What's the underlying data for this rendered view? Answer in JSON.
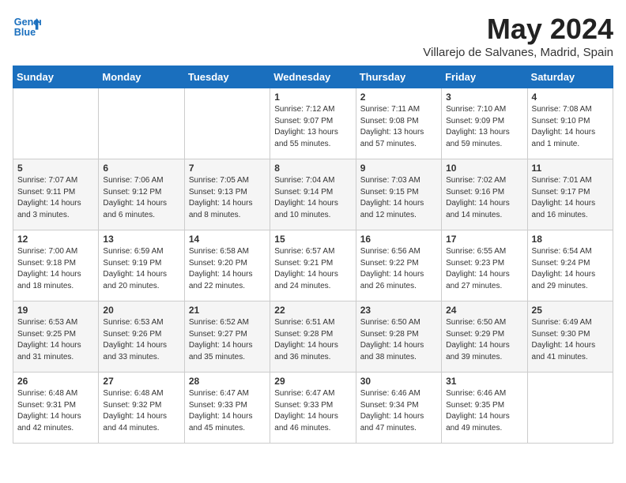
{
  "header": {
    "logo_line1": "General",
    "logo_line2": "Blue",
    "month_title": "May 2024",
    "location": "Villarejo de Salvanes, Madrid, Spain"
  },
  "weekdays": [
    "Sunday",
    "Monday",
    "Tuesday",
    "Wednesday",
    "Thursday",
    "Friday",
    "Saturday"
  ],
  "weeks": [
    [
      {
        "day": "",
        "sunrise": "",
        "sunset": "",
        "daylight": ""
      },
      {
        "day": "",
        "sunrise": "",
        "sunset": "",
        "daylight": ""
      },
      {
        "day": "",
        "sunrise": "",
        "sunset": "",
        "daylight": ""
      },
      {
        "day": "1",
        "sunrise": "Sunrise: 7:12 AM",
        "sunset": "Sunset: 9:07 PM",
        "daylight": "Daylight: 13 hours and 55 minutes."
      },
      {
        "day": "2",
        "sunrise": "Sunrise: 7:11 AM",
        "sunset": "Sunset: 9:08 PM",
        "daylight": "Daylight: 13 hours and 57 minutes."
      },
      {
        "day": "3",
        "sunrise": "Sunrise: 7:10 AM",
        "sunset": "Sunset: 9:09 PM",
        "daylight": "Daylight: 13 hours and 59 minutes."
      },
      {
        "day": "4",
        "sunrise": "Sunrise: 7:08 AM",
        "sunset": "Sunset: 9:10 PM",
        "daylight": "Daylight: 14 hours and 1 minute."
      }
    ],
    [
      {
        "day": "5",
        "sunrise": "Sunrise: 7:07 AM",
        "sunset": "Sunset: 9:11 PM",
        "daylight": "Daylight: 14 hours and 3 minutes."
      },
      {
        "day": "6",
        "sunrise": "Sunrise: 7:06 AM",
        "sunset": "Sunset: 9:12 PM",
        "daylight": "Daylight: 14 hours and 6 minutes."
      },
      {
        "day": "7",
        "sunrise": "Sunrise: 7:05 AM",
        "sunset": "Sunset: 9:13 PM",
        "daylight": "Daylight: 14 hours and 8 minutes."
      },
      {
        "day": "8",
        "sunrise": "Sunrise: 7:04 AM",
        "sunset": "Sunset: 9:14 PM",
        "daylight": "Daylight: 14 hours and 10 minutes."
      },
      {
        "day": "9",
        "sunrise": "Sunrise: 7:03 AM",
        "sunset": "Sunset: 9:15 PM",
        "daylight": "Daylight: 14 hours and 12 minutes."
      },
      {
        "day": "10",
        "sunrise": "Sunrise: 7:02 AM",
        "sunset": "Sunset: 9:16 PM",
        "daylight": "Daylight: 14 hours and 14 minutes."
      },
      {
        "day": "11",
        "sunrise": "Sunrise: 7:01 AM",
        "sunset": "Sunset: 9:17 PM",
        "daylight": "Daylight: 14 hours and 16 minutes."
      }
    ],
    [
      {
        "day": "12",
        "sunrise": "Sunrise: 7:00 AM",
        "sunset": "Sunset: 9:18 PM",
        "daylight": "Daylight: 14 hours and 18 minutes."
      },
      {
        "day": "13",
        "sunrise": "Sunrise: 6:59 AM",
        "sunset": "Sunset: 9:19 PM",
        "daylight": "Daylight: 14 hours and 20 minutes."
      },
      {
        "day": "14",
        "sunrise": "Sunrise: 6:58 AM",
        "sunset": "Sunset: 9:20 PM",
        "daylight": "Daylight: 14 hours and 22 minutes."
      },
      {
        "day": "15",
        "sunrise": "Sunrise: 6:57 AM",
        "sunset": "Sunset: 9:21 PM",
        "daylight": "Daylight: 14 hours and 24 minutes."
      },
      {
        "day": "16",
        "sunrise": "Sunrise: 6:56 AM",
        "sunset": "Sunset: 9:22 PM",
        "daylight": "Daylight: 14 hours and 26 minutes."
      },
      {
        "day": "17",
        "sunrise": "Sunrise: 6:55 AM",
        "sunset": "Sunset: 9:23 PM",
        "daylight": "Daylight: 14 hours and 27 minutes."
      },
      {
        "day": "18",
        "sunrise": "Sunrise: 6:54 AM",
        "sunset": "Sunset: 9:24 PM",
        "daylight": "Daylight: 14 hours and 29 minutes."
      }
    ],
    [
      {
        "day": "19",
        "sunrise": "Sunrise: 6:53 AM",
        "sunset": "Sunset: 9:25 PM",
        "daylight": "Daylight: 14 hours and 31 minutes."
      },
      {
        "day": "20",
        "sunrise": "Sunrise: 6:53 AM",
        "sunset": "Sunset: 9:26 PM",
        "daylight": "Daylight: 14 hours and 33 minutes."
      },
      {
        "day": "21",
        "sunrise": "Sunrise: 6:52 AM",
        "sunset": "Sunset: 9:27 PM",
        "daylight": "Daylight: 14 hours and 35 minutes."
      },
      {
        "day": "22",
        "sunrise": "Sunrise: 6:51 AM",
        "sunset": "Sunset: 9:28 PM",
        "daylight": "Daylight: 14 hours and 36 minutes."
      },
      {
        "day": "23",
        "sunrise": "Sunrise: 6:50 AM",
        "sunset": "Sunset: 9:28 PM",
        "daylight": "Daylight: 14 hours and 38 minutes."
      },
      {
        "day": "24",
        "sunrise": "Sunrise: 6:50 AM",
        "sunset": "Sunset: 9:29 PM",
        "daylight": "Daylight: 14 hours and 39 minutes."
      },
      {
        "day": "25",
        "sunrise": "Sunrise: 6:49 AM",
        "sunset": "Sunset: 9:30 PM",
        "daylight": "Daylight: 14 hours and 41 minutes."
      }
    ],
    [
      {
        "day": "26",
        "sunrise": "Sunrise: 6:48 AM",
        "sunset": "Sunset: 9:31 PM",
        "daylight": "Daylight: 14 hours and 42 minutes."
      },
      {
        "day": "27",
        "sunrise": "Sunrise: 6:48 AM",
        "sunset": "Sunset: 9:32 PM",
        "daylight": "Daylight: 14 hours and 44 minutes."
      },
      {
        "day": "28",
        "sunrise": "Sunrise: 6:47 AM",
        "sunset": "Sunset: 9:33 PM",
        "daylight": "Daylight: 14 hours and 45 minutes."
      },
      {
        "day": "29",
        "sunrise": "Sunrise: 6:47 AM",
        "sunset": "Sunset: 9:33 PM",
        "daylight": "Daylight: 14 hours and 46 minutes."
      },
      {
        "day": "30",
        "sunrise": "Sunrise: 6:46 AM",
        "sunset": "Sunset: 9:34 PM",
        "daylight": "Daylight: 14 hours and 47 minutes."
      },
      {
        "day": "31",
        "sunrise": "Sunrise: 6:46 AM",
        "sunset": "Sunset: 9:35 PM",
        "daylight": "Daylight: 14 hours and 49 minutes."
      },
      {
        "day": "",
        "sunrise": "",
        "sunset": "",
        "daylight": ""
      }
    ]
  ]
}
